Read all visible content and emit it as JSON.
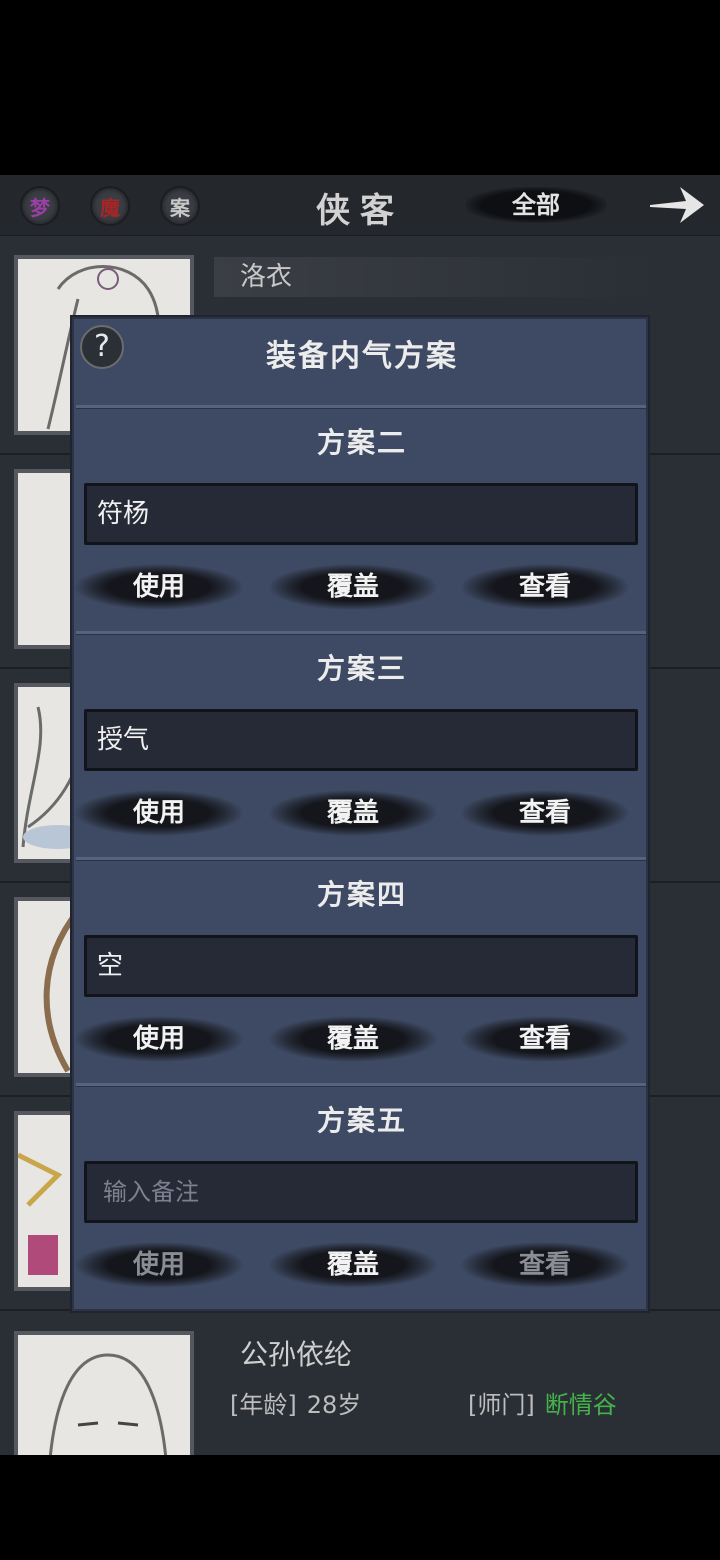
{
  "header": {
    "btn_meng": "梦",
    "btn_mo": "魔",
    "btn_an": "案",
    "title": "侠客",
    "filter": "全部",
    "arrow_icon": "arrow-right-icon"
  },
  "list": {
    "first_name": "洛衣",
    "last": {
      "name": "公孙依纶",
      "age_label": "[年龄]",
      "age_value": "28岁",
      "sect_label": "[师门]",
      "sect_value": "断情谷"
    }
  },
  "modal": {
    "help": "?",
    "title": "装备内气方案",
    "plans": [
      {
        "title": "方案二",
        "value": "符杨",
        "placeholder": "",
        "use": "使用",
        "cover": "覆盖",
        "view": "查看",
        "use_disabled": false,
        "view_disabled": false
      },
      {
        "title": "方案三",
        "value": "授气",
        "placeholder": "",
        "use": "使用",
        "cover": "覆盖",
        "view": "查看",
        "use_disabled": false,
        "view_disabled": false
      },
      {
        "title": "方案四",
        "value": "空",
        "placeholder": "",
        "use": "使用",
        "cover": "覆盖",
        "view": "查看",
        "use_disabled": false,
        "view_disabled": false
      },
      {
        "title": "方案五",
        "value": "",
        "placeholder": "输入备注",
        "use": "使用",
        "cover": "覆盖",
        "view": "查看",
        "use_disabled": true,
        "view_disabled": true
      }
    ]
  },
  "colors": {
    "modal_bg": "#3e4a63",
    "green": "#43b34a"
  }
}
